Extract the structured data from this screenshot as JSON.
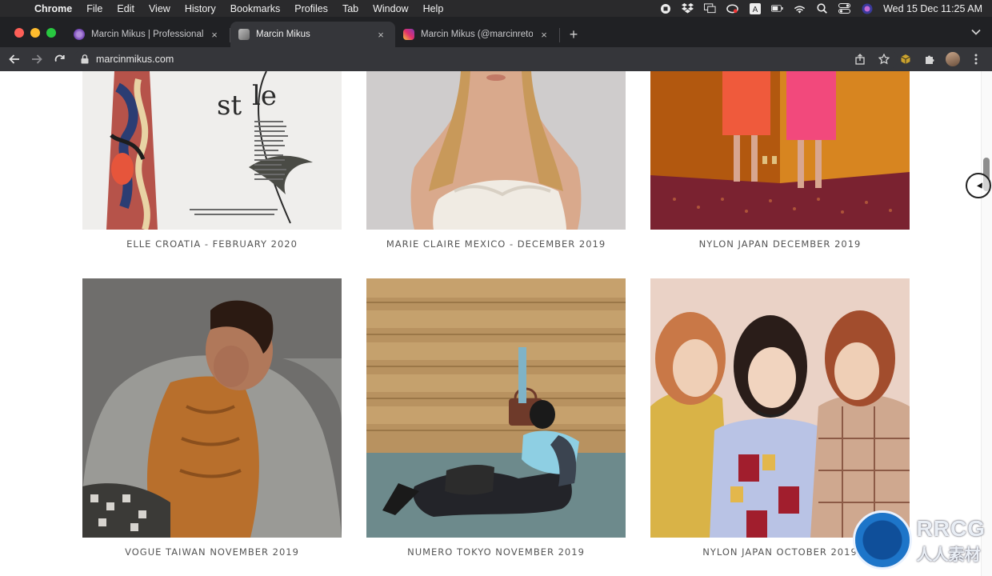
{
  "menubar": {
    "app_name": "Chrome",
    "items": [
      "File",
      "Edit",
      "View",
      "History",
      "Bookmarks",
      "Profiles",
      "Tab",
      "Window",
      "Help"
    ],
    "clock": "Wed 15 Dec  11:25 AM"
  },
  "tabs": [
    {
      "title": "Marcin Mikus | Professional Re",
      "close": "×",
      "active": false
    },
    {
      "title": "Marcin Mikus",
      "close": "×",
      "active": true
    },
    {
      "title": "Marcin Mikus (@marcinretouc",
      "close": "×",
      "active": false
    }
  ],
  "toolbar": {
    "url": "marcinmikus.com",
    "new_tab_label": "+"
  },
  "gallery": [
    {
      "caption": "ELLE CROATIA - FEBRUARY 2020"
    },
    {
      "caption": "MARIE CLAIRE MEXICO - DECEMBER 2019"
    },
    {
      "caption": "NYLON JAPAN DECEMBER 2019"
    },
    {
      "caption": "VOGUE TAIWAN NOVEMBER 2019"
    },
    {
      "caption": "NUMERO TOKYO NOVEMBER 2019"
    },
    {
      "caption": "NYLON JAPAN OCTOBER 2019"
    }
  ],
  "watermark": {
    "line1": "RRCG",
    "line2": "人人素材"
  }
}
